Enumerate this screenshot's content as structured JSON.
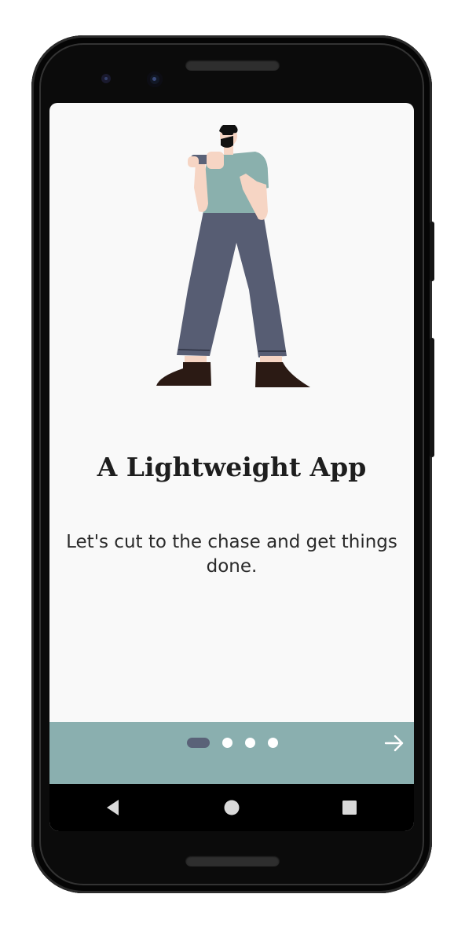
{
  "onboarding": {
    "title": "A Lightweight App",
    "subtitle": "Let's cut to the chase and get things done.",
    "page_indicator": {
      "current": 1,
      "total": 4
    },
    "next_icon": "arrow-right-icon"
  },
  "system_nav": {
    "back_icon": "back-triangle-icon",
    "home_icon": "home-circle-icon",
    "recents_icon": "recents-square-icon"
  },
  "colors": {
    "screen_background": "#f9f9f9",
    "bottom_bar": "#8aafaf",
    "indicator_active": "#5a6278",
    "indicator_inactive": "#ffffff",
    "title_text": "#1e1e1e"
  }
}
